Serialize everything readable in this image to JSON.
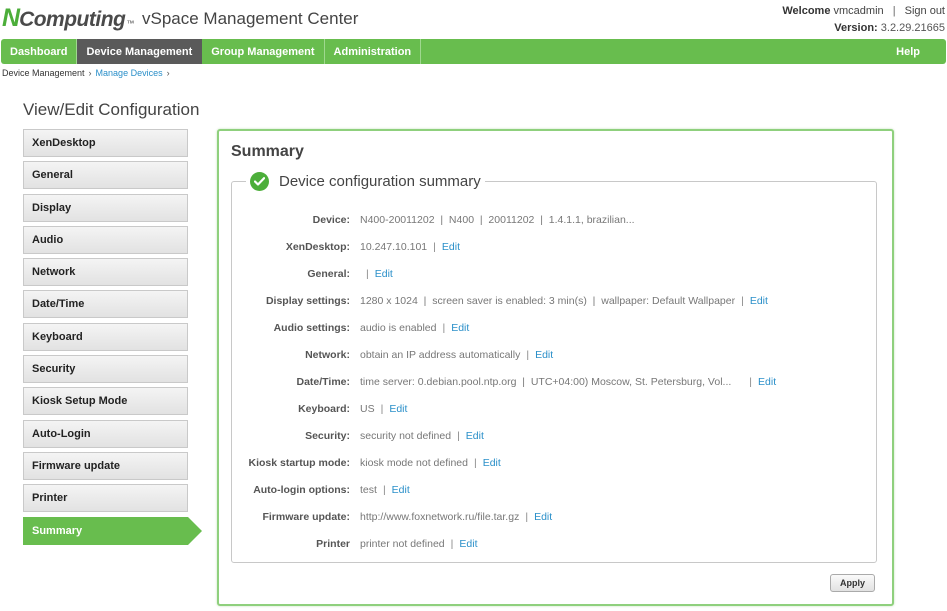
{
  "header": {
    "logo_n": "N",
    "logo_rest": "Computing",
    "logo_tm": "™",
    "app_title": "vSpace Management Center",
    "welcome_label": "Welcome",
    "username": "vmcadmin",
    "sign_out": "Sign out",
    "version_label": "Version:",
    "version_value": "3.2.29.21665"
  },
  "nav": {
    "items": [
      {
        "label": "Dashboard"
      },
      {
        "label": "Device Management"
      },
      {
        "label": "Group Management"
      },
      {
        "label": "Administration"
      }
    ],
    "active_index": 1,
    "help": "Help"
  },
  "breadcrumb": {
    "root": "Device Management",
    "link": "Manage Devices",
    "arrow": "›"
  },
  "page_title": "View/Edit Configuration",
  "menu": {
    "items": [
      {
        "label": "XenDesktop"
      },
      {
        "label": "General"
      },
      {
        "label": "Display"
      },
      {
        "label": "Audio"
      },
      {
        "label": "Network"
      },
      {
        "label": "Date/Time"
      },
      {
        "label": "Keyboard"
      },
      {
        "label": "Security"
      },
      {
        "label": "Kiosk Setup Mode"
      },
      {
        "label": "Auto-Login"
      },
      {
        "label": "Firmware update"
      },
      {
        "label": "Printer"
      },
      {
        "label": "Summary"
      }
    ],
    "active_index": 12
  },
  "panel": {
    "title": "Summary",
    "legend": "Device configuration summary",
    "edit_label": "Edit",
    "pipe": "|",
    "apply": "Apply",
    "rows": [
      {
        "label": "Device:",
        "value": "N400-20011202  |  N400  |  20011202  |  1.4.1.1, brazilian...",
        "edit": false
      },
      {
        "label": "XenDesktop:",
        "value": "10.247.10.101",
        "edit": true
      },
      {
        "label": "General:",
        "value": "",
        "edit": true
      },
      {
        "label": "Display settings:",
        "value": "1280 x 1024  |  screen saver is enabled: 3 min(s)  |  wallpaper: Default Wallpaper",
        "edit": true
      },
      {
        "label": "Audio settings:",
        "value": "audio is enabled",
        "edit": true
      },
      {
        "label": "Network:",
        "value": "obtain an IP address automatically",
        "edit": true
      },
      {
        "label": "Date/Time:",
        "value": "time server: 0.debian.pool.ntp.org  |  UTC+04:00) Moscow, St. Petersburg, Vol...",
        "edit": true,
        "gap": true
      },
      {
        "label": "Keyboard:",
        "value": "US",
        "edit": true
      },
      {
        "label": "Security:",
        "value": "security not defined",
        "edit": true
      },
      {
        "label": "Kiosk startup mode:",
        "value": "kiosk mode not defined",
        "edit": true
      },
      {
        "label": "Auto-login options:",
        "value": "test",
        "edit": true
      },
      {
        "label": "Firmware update:",
        "value": "http://www.foxnetwork.ru/file.tar.gz",
        "edit": true
      },
      {
        "label": "Printer",
        "value": "printer not defined",
        "edit": true
      }
    ]
  },
  "colors": {
    "brand_green": "#68bd4e",
    "nav_active": "#5a5a5a",
    "link_blue": "#2a8fc9"
  }
}
